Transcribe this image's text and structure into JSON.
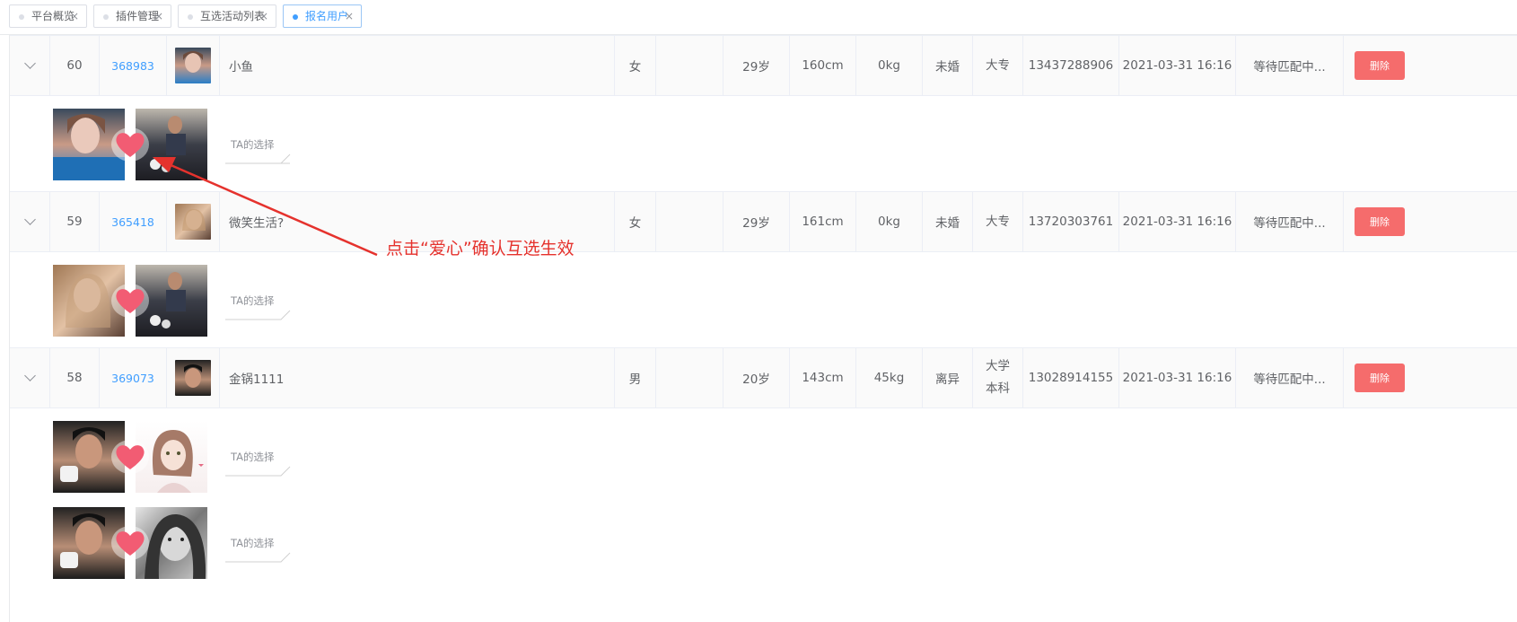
{
  "tabs": [
    {
      "label": "平台概览",
      "active": false
    },
    {
      "label": "插件管理",
      "active": false
    },
    {
      "label": "互选活动列表",
      "active": false
    },
    {
      "label": "报名用户",
      "active": true
    }
  ],
  "tab_close_glyph": "×",
  "rows": [
    {
      "index": "60",
      "uid": "368983",
      "name": "小鱼",
      "gender": "女",
      "extra": "",
      "age": "29岁",
      "height": "160cm",
      "weight": "0kg",
      "marital": "未婚",
      "education": [
        "大专"
      ],
      "phone": "13437288906",
      "time": "2021-03-31 16:16",
      "status": "等待匹配中...",
      "delete_label": "删除",
      "pairs": [
        {
          "ta_label": "TA的选择"
        }
      ]
    },
    {
      "index": "59",
      "uid": "365418",
      "name": "微笑生活?",
      "gender": "女",
      "extra": "",
      "age": "29岁",
      "height": "161cm",
      "weight": "0kg",
      "marital": "未婚",
      "education": [
        "大专"
      ],
      "phone": "13720303761",
      "time": "2021-03-31 16:16",
      "status": "等待匹配中...",
      "delete_label": "删除",
      "pairs": [
        {
          "ta_label": "TA的选择"
        }
      ]
    },
    {
      "index": "58",
      "uid": "369073",
      "name": "金锅1111",
      "gender": "男",
      "extra": "",
      "age": "20岁",
      "height": "143cm",
      "weight": "45kg",
      "marital": "离异",
      "education": [
        "大学",
        "本科"
      ],
      "phone": "13028914155",
      "time": "2021-03-31 16:16",
      "status": "等待匹配中...",
      "delete_label": "删除",
      "pairs": [
        {
          "ta_label": "TA的选择"
        },
        {
          "ta_label": "TA的选择"
        }
      ]
    }
  ],
  "annotation": "点击“爱心”确认互选生效",
  "colors": {
    "accent": "#409eff",
    "danger": "#f56c6c",
    "heart": "#f25c73",
    "annotation": "#e5322d"
  }
}
